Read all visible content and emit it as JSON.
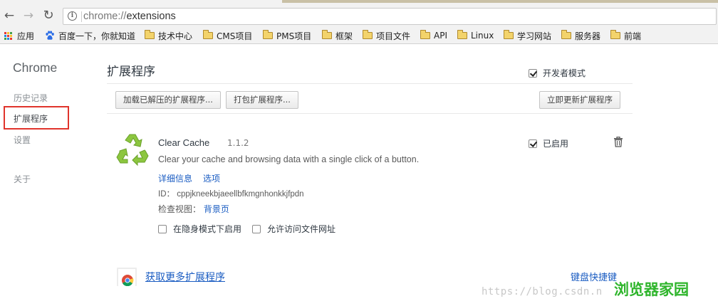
{
  "browser": {
    "url_scheme": "chrome://",
    "url_path": "extensions",
    "back_glyph": "←",
    "forward_glyph": "→",
    "reload_glyph": "↻",
    "info_glyph": "i"
  },
  "bookmarks": [
    {
      "label": "应用",
      "icon": "apps-grid-icon"
    },
    {
      "label": "百度一下，你就知道",
      "icon": "baidu-paw-icon"
    },
    {
      "label": "技术中心",
      "icon": "folder-icon"
    },
    {
      "label": "CMS项目",
      "icon": "folder-icon"
    },
    {
      "label": "PMS项目",
      "icon": "folder-icon"
    },
    {
      "label": "框架",
      "icon": "folder-icon"
    },
    {
      "label": "项目文件",
      "icon": "folder-icon"
    },
    {
      "label": "API",
      "icon": "folder-icon"
    },
    {
      "label": "Linux",
      "icon": "folder-icon"
    },
    {
      "label": "学习网站",
      "icon": "folder-icon"
    },
    {
      "label": "服务器",
      "icon": "folder-icon"
    },
    {
      "label": "前端",
      "icon": "folder-icon"
    }
  ],
  "sidebar": {
    "brand": "Chrome",
    "items": [
      {
        "label": "历史记录"
      },
      {
        "label": "扩展程序",
        "selected": true
      },
      {
        "label": "设置"
      },
      {
        "label": "关于"
      }
    ]
  },
  "main": {
    "title": "扩展程序",
    "developer_mode": {
      "label": "开发者模式",
      "checked": true
    },
    "buttons": {
      "load_unpacked": "加载已解压的扩展程序...",
      "pack": "打包扩展程序...",
      "update_now": "立即更新扩展程序"
    }
  },
  "extension": {
    "name": "Clear Cache",
    "version": "1.1.2",
    "description": "Clear your cache and browsing data with a single click of a button.",
    "details_link": "详细信息",
    "options_link": "选项",
    "id_label": "ID：",
    "id_value": "cppjkneekbjaeellbfkmgnhonkkjfpdn",
    "views_label": "检查视图：",
    "views_link": "背景页",
    "incognito_label": "在隐身模式下启用",
    "incognito_checked": false,
    "file_urls_label": "允许访问文件网址",
    "file_urls_checked": false,
    "enabled_label": "已启用",
    "enabled_checked": true,
    "icon_color": "#8cc63f"
  },
  "footer": {
    "get_more": "获取更多扩展程序",
    "shortcuts": "键盘快捷键"
  },
  "watermark": {
    "url": "https://blog.csdn.n",
    "logo": "浏览器家园"
  },
  "colors": {
    "link": "#1a5cc2",
    "highlight_box": "#e0342c",
    "watermark_logo": "#2fb52c"
  }
}
